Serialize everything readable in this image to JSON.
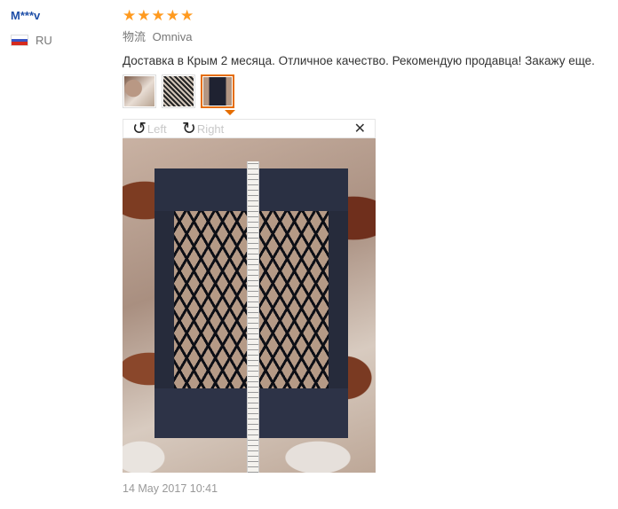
{
  "user": {
    "name": "M***v",
    "country_code": "RU",
    "flag_icon": "russia-flag-icon"
  },
  "review": {
    "rating": 5,
    "rating_max": 5,
    "star_color": "#ff9a1f",
    "logistics_label": "物流",
    "logistics_value": "Omniva",
    "text": "Доставка в Крым 2 месяца. Отличное качество. Рекомендую продавца! Закажу еще.",
    "thumbnails": [
      {
        "name": "photo-thumb-1",
        "active": false
      },
      {
        "name": "photo-thumb-2",
        "active": false
      },
      {
        "name": "photo-thumb-3",
        "active": true
      }
    ],
    "active_color": "#e56d00",
    "date": "14 May 2017 10:41"
  },
  "viewer": {
    "rotate_left_label": "Left",
    "rotate_right_label": "Right",
    "rotate_left_icon": "rotate-left-icon",
    "rotate_right_icon": "rotate-right-icon",
    "close_icon": "close-icon",
    "close_symbol": "✕"
  }
}
